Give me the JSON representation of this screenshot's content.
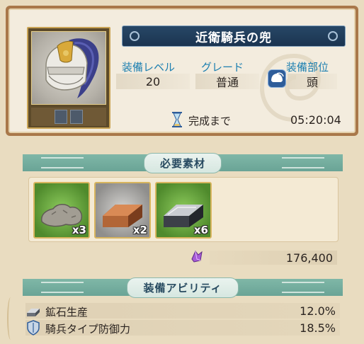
{
  "item": {
    "name": "近衛騎兵の兜",
    "icon": "helmet-with-plume"
  },
  "stats": {
    "level_label": "装備レベル",
    "level_value": "20",
    "grade_label": "グレード",
    "grade_value": "普通",
    "slot_label": "装備部位",
    "slot_value": "頭",
    "slot_icon": "helmet-icon"
  },
  "timer": {
    "label": "完成まで",
    "value": "05:20:04",
    "icon": "hourglass-icon"
  },
  "materials": {
    "title": "必要素材",
    "items": [
      {
        "icon": "ore-rock-icon",
        "count": "x3",
        "bg": "#6aaa3e"
      },
      {
        "icon": "copper-ingot-icon",
        "count": "x2",
        "bg": "#b5b4b1"
      },
      {
        "icon": "iron-ingot-icon",
        "count": "x6",
        "bg": "#6aaa3e"
      }
    ],
    "cost_icon": "purple-gem-icon",
    "cost_value": "176,400"
  },
  "abilities": {
    "title": "装備アビリティ",
    "items": [
      {
        "icon": "ore-ingot-icon",
        "label": "鉱石生産",
        "value": "12.0%"
      },
      {
        "icon": "shield-icon",
        "label": "騎兵タイプ防御力",
        "value": "18.5%"
      }
    ]
  },
  "colors": {
    "frame": "#a9784a",
    "banner": "#1b3450",
    "section_header": "#6aa496",
    "stat_label": "#1c7fb0"
  }
}
